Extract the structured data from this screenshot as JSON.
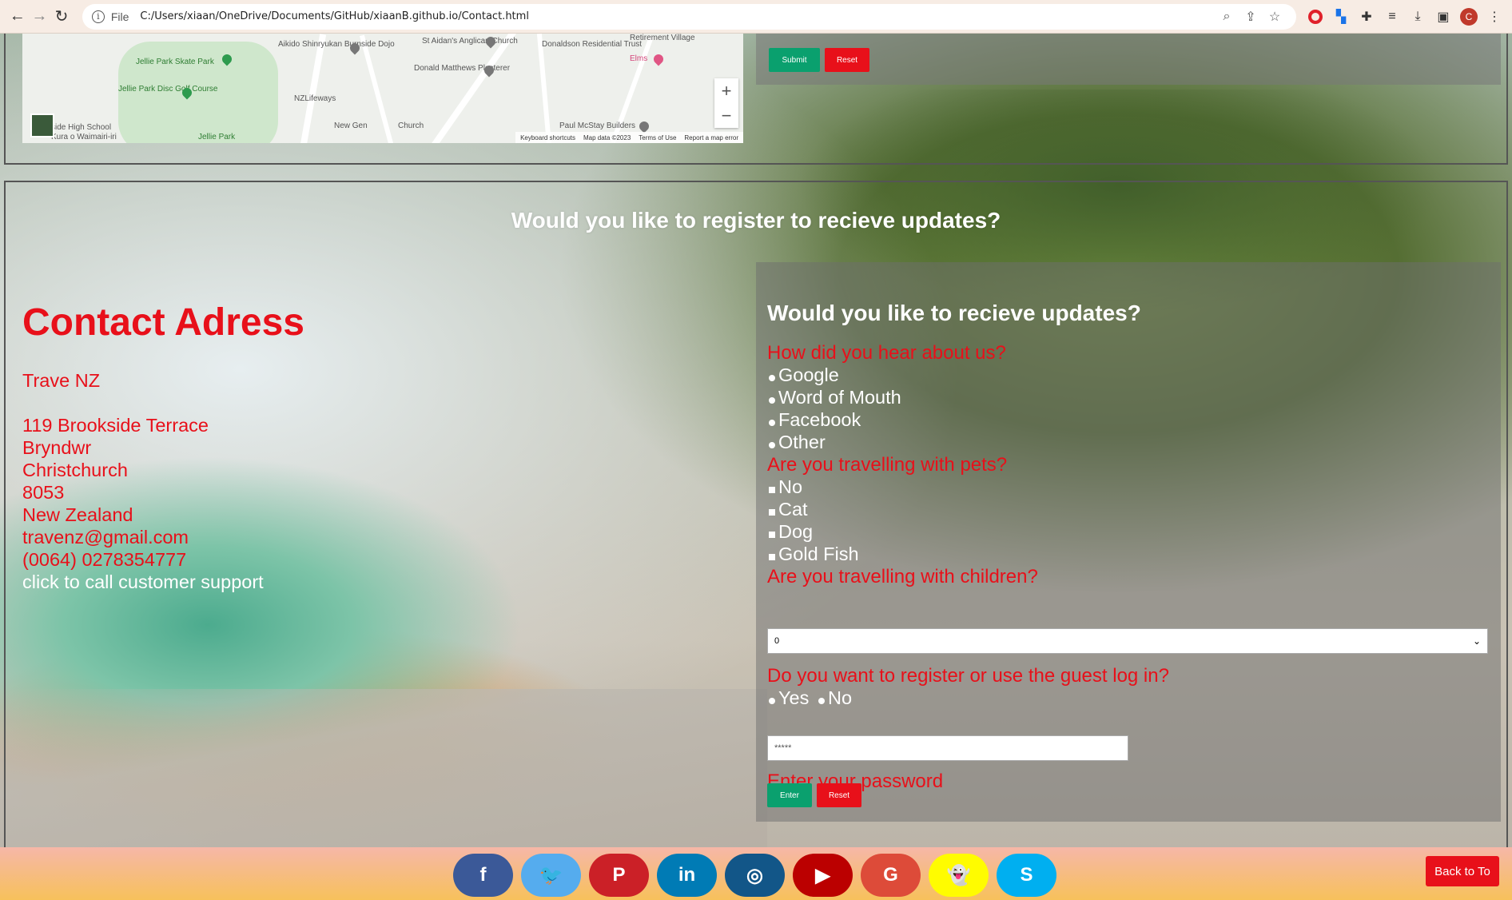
{
  "browser": {
    "scheme": "File",
    "url": "C:/Users/xiaan/OneDrive/Documents/GitHub/xiaanB.github.io/Contact.html",
    "avatar_letter": "C"
  },
  "map": {
    "labels": {
      "jellie_skate": "Jellie Park Skate Park",
      "aikido": "Aikido Shinryukan Burnside Dojo",
      "st_aidans": "St Aidan's Anglican Church",
      "donaldson": "Donaldson Residential Trust",
      "retirement": "Retirement Village",
      "elms": "Elms",
      "jellie_disc": "Jellie Park Disc Golf Course",
      "donald_matthews": "Donald Matthews Plasterer",
      "nzlifeways": "NZLifeways",
      "side_high": "side High School",
      "kura": "Kura o Waimairi-iri",
      "jellie_park": "Jellie Park",
      "new_gen": "New Gen",
      "church": "Church",
      "paul_mcstay": "Paul McStay Builders"
    },
    "footer": [
      "Keyboard shortcuts",
      "Map data ©2023",
      "Terms of Use",
      "Report a map error"
    ],
    "zoom_in": "+",
    "zoom_out": "−"
  },
  "top_form": {
    "submit": "Submit",
    "reset": "Reset"
  },
  "headline": "Would you like to register to recieve updates?",
  "contact": {
    "title": "Contact Adress",
    "company": "Trave NZ",
    "street": "119 Brookside Terrace",
    "suburb": "Bryndwr",
    "city": "Christchurch",
    "postcode": "8053",
    "country": "New Zealand",
    "email": "travenz@gmail.com",
    "phone": "(0064) 0278354777",
    "call_link": "click to call customer support"
  },
  "form": {
    "title": "Would you like to recieve updates?",
    "q_hear": "How did you hear about us?",
    "hear_options": [
      "Google",
      "Word of Mouth",
      "Facebook",
      "Other"
    ],
    "q_pets": "Are you travelling with pets?",
    "pet_options": [
      "No",
      "Cat",
      "Dog",
      "Gold Fish"
    ],
    "q_children": "Are you travelling with children?",
    "children_value": "0",
    "q_register": "Do you want to register or use the guest log in?",
    "register_yes": "Yes",
    "register_no": "No",
    "password_value": "*****",
    "password_label": "Enter your password",
    "enter": "Enter",
    "reset": "Reset"
  },
  "social": [
    {
      "name": "facebook",
      "glyph": "f",
      "color": "#3b5998"
    },
    {
      "name": "twitter",
      "glyph": "🐦",
      "color": "#55acee"
    },
    {
      "name": "pinterest",
      "glyph": "P",
      "color": "#cb2027"
    },
    {
      "name": "linkedin",
      "glyph": "in",
      "color": "#007bb5"
    },
    {
      "name": "instagram",
      "glyph": "◎",
      "color": "#125688"
    },
    {
      "name": "youtube",
      "glyph": "▶",
      "color": "#bb0000"
    },
    {
      "name": "google",
      "glyph": "G",
      "color": "#dd4b39"
    },
    {
      "name": "snapchat",
      "glyph": "👻",
      "color": "#fffc00"
    },
    {
      "name": "skype",
      "glyph": "S",
      "color": "#00aff0"
    }
  ],
  "back_to_top": "Back to To"
}
